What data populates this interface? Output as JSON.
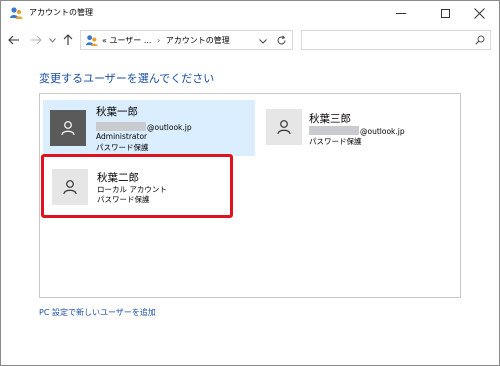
{
  "window": {
    "title": "アカウントの管理"
  },
  "address_bar": {
    "prefix": "«",
    "segments": [
      "ユーザー ...",
      "アカウントの管理"
    ],
    "separator": "›"
  },
  "search": {
    "placeholder": ""
  },
  "heading": "変更するユーザーを選んでください",
  "accounts": [
    {
      "name": "秋葉一郎",
      "email_suffix": "@outlook.jp",
      "role": "Administrator",
      "protection": "パスワード保護",
      "selected": true
    },
    {
      "name": "秋葉三郎",
      "email_suffix": "@outlook.jp",
      "protection": "パスワード保護"
    },
    {
      "name": "秋葉二郎",
      "type": "ローカル アカウント",
      "protection": "パスワード保護",
      "highlighted": true
    }
  ],
  "add_user_link": "PC 設定で新しいユーザーを追加",
  "colors": {
    "link": "#1a4fa3",
    "selection": "#dbeeff",
    "highlight_border": "#e0121f",
    "avatar_dark": "#5a5a5a",
    "avatar_light": "#e6e6e6"
  }
}
